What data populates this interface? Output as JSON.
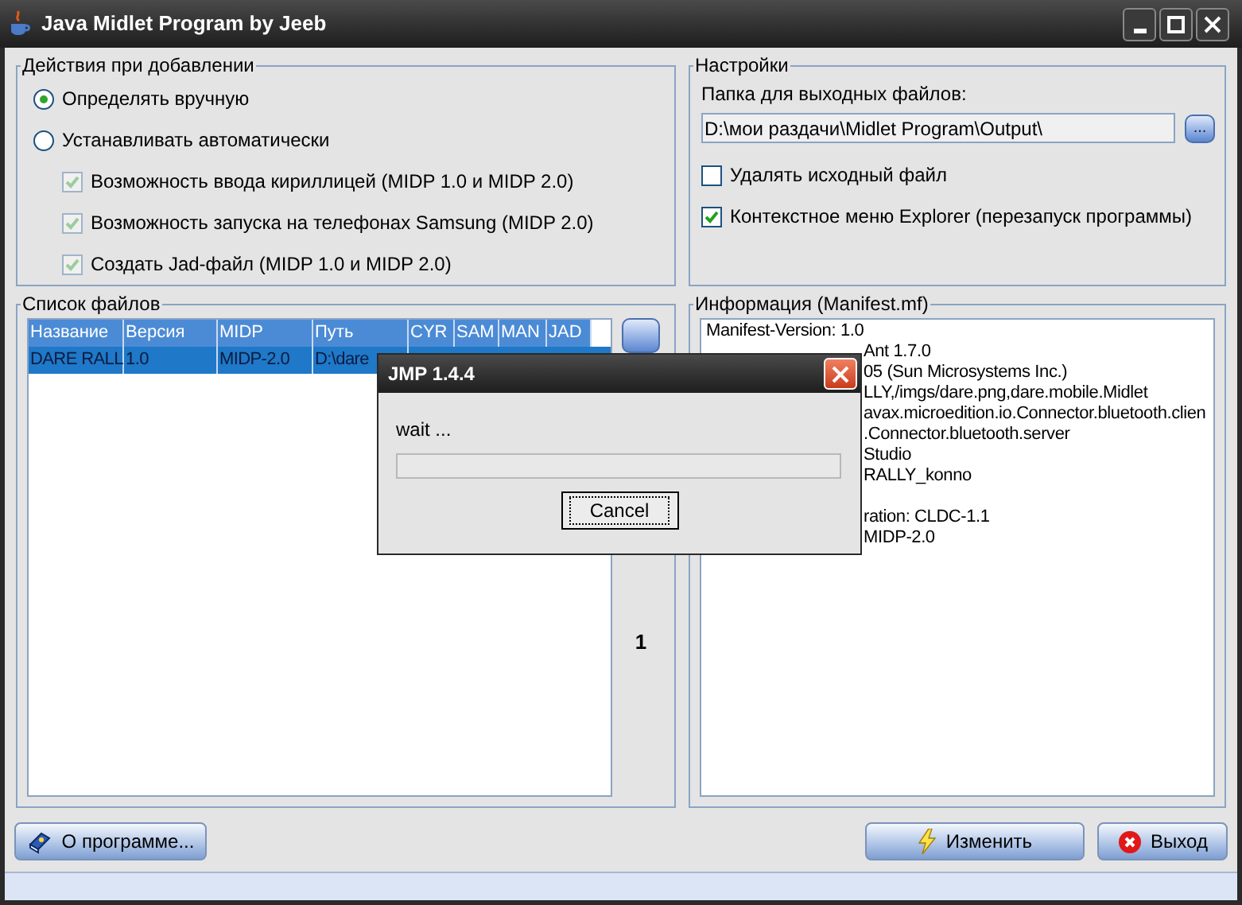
{
  "window": {
    "title": "Java Midlet Program by Jeeb"
  },
  "actions_group": {
    "title": "Действия при добавлении",
    "radios": [
      {
        "label": "Определять вручную",
        "selected": true
      },
      {
        "label": "Устанавливать автоматически",
        "selected": false
      }
    ],
    "checkboxes": [
      {
        "label": "Возможность ввода кириллицей (MIDP 1.0 и MIDP 2.0)",
        "checked": true,
        "disabled": true
      },
      {
        "label": "Возможность запуска на телефонах Samsung (MIDP 2.0)",
        "checked": true,
        "disabled": true
      },
      {
        "label": "Создать Jad-файл (MIDP 1.0 и MIDP 2.0)",
        "checked": true,
        "disabled": true
      }
    ]
  },
  "settings_group": {
    "title": "Настройки",
    "folder_label": "Папка для выходных файлов:",
    "folder_value": "D:\\мои раздачи\\Midlet Program\\Output\\",
    "browse_button": "...",
    "checkboxes": [
      {
        "label": "Удалять исходный файл",
        "checked": false
      },
      {
        "label": "Контекстное меню Explorer (перезапуск программы)",
        "checked": true
      }
    ]
  },
  "files_group": {
    "title": "Список файлов",
    "table": {
      "columns": [
        "Название",
        "Версия",
        "MIDP",
        "Путь",
        "CYR",
        "SAM",
        "MAN",
        "JAD"
      ],
      "rows": [
        {
          "cells": [
            "DARE RALL",
            "1.0",
            "MIDP-2.0",
            "D:\\dare"
          ],
          "selected": true
        }
      ]
    },
    "count": "1"
  },
  "info_group": {
    "title": "Информация (Manifest.mf)",
    "first_line": "Manifest-Version: 1.0",
    "fragments": [
      "Ant 1.7.0",
      "05 (Sun Microsystems Inc.)",
      "LLY,/imgs/dare.png,dare.mobile.Midlet",
      "avax.microedition.io.Connector.bluetooth.clien",
      ".Connector.bluetooth.server",
      "Studio",
      "RALLY_konno"
    ],
    "fragments_after_blank": [
      "ration: CLDC-1.1",
      "MIDP-2.0"
    ]
  },
  "buttons": {
    "about": "О программе...",
    "change": "Изменить",
    "exit": "Выход"
  },
  "dialog": {
    "title": "JMP 1.4.4",
    "message": "wait ...",
    "progress": {
      "level": 0
    },
    "cancel": "Cancel"
  }
}
